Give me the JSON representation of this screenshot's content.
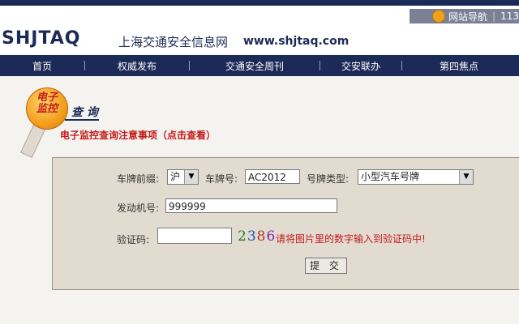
{
  "header": {
    "logo": "SHJTAQ",
    "site_name": "上海交通安全信息网",
    "url": "www.shjtaq.com",
    "top_link": "网站导航",
    "top_extra": "113"
  },
  "nav": {
    "items": [
      "首页",
      "权威发布",
      "交通安全周刊",
      "交安联办",
      "第四焦点"
    ]
  },
  "emblem": {
    "line1": "电子",
    "line2": "监控"
  },
  "query_label": "查 询",
  "notice": "电子监控查询注意事项（点击查看）",
  "form": {
    "plate_prefix_label": "车牌前缀:",
    "plate_prefix_value": "沪",
    "plate_no_label": "车牌号:",
    "plate_no_value": "AC2012",
    "plate_type_label": "号牌类型:",
    "plate_type_value": "小型汽车号牌",
    "engine_label": "发动机号:",
    "engine_value": "999999",
    "captcha_label": "验证码:",
    "captcha_value": "",
    "captcha_digits": [
      "2",
      "3",
      "8",
      "6"
    ],
    "captcha_hint": "请将图片里的数字输入到验证码中!",
    "submit_label": "提 交"
  }
}
